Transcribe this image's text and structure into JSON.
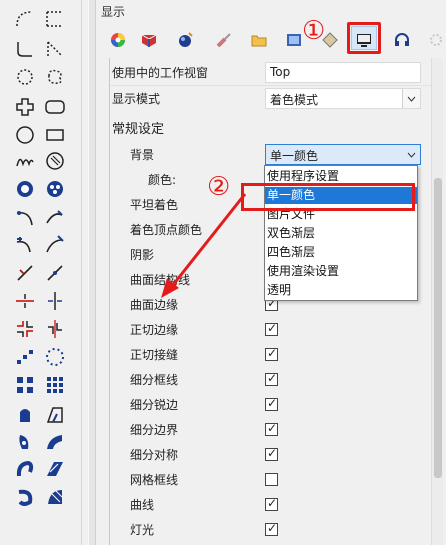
{
  "panel": {
    "title": "显示"
  },
  "rows": {
    "viewport_label": "使用中的工作视窗",
    "viewport_value": "Top",
    "display_mode_label": "显示模式",
    "display_mode_value": "着色模式",
    "general_label": "常规设定",
    "background_label": "背景",
    "background_value": "单一颜色",
    "color_label": "颜色:",
    "flat_shading_label": "平坦着色",
    "vertex_color_label": "着色顶点颜色",
    "shadow_label": "阴影",
    "surface_iso_label": "曲面结构线",
    "surface_edge_label": "曲面边缘",
    "tangent_edge_label": "正切边缘",
    "tangent_seam_label": "正切接缝",
    "mesh_wire_label": "细分框线",
    "mesh_crease_label": "细分锐边",
    "mesh_border_label": "细分边界",
    "mesh_symmetry_label": "细分对称",
    "mesh_wireframe_label": "网格框线",
    "curves_label": "曲线",
    "lights_label": "灯光"
  },
  "checkboxes": {
    "surface_edge": true,
    "tangent_edge": true,
    "tangent_seam": true,
    "mesh_wire": true,
    "mesh_crease": true,
    "mesh_border": true,
    "mesh_symmetry": true,
    "mesh_wireframe": false,
    "curves": true,
    "lights": true
  },
  "dropdown": {
    "options": [
      "使用程序设置",
      "单一颜色",
      "图片文件",
      "双色渐层",
      "四色渐层",
      "使用渲染设置",
      "透明"
    ],
    "selected": "单一颜色"
  },
  "annotations": {
    "one": "①",
    "two": "②"
  },
  "colors": {
    "highlight": "#e41b1b",
    "selection": "#1e78d7",
    "tool_blue": "#1a3d8f"
  }
}
